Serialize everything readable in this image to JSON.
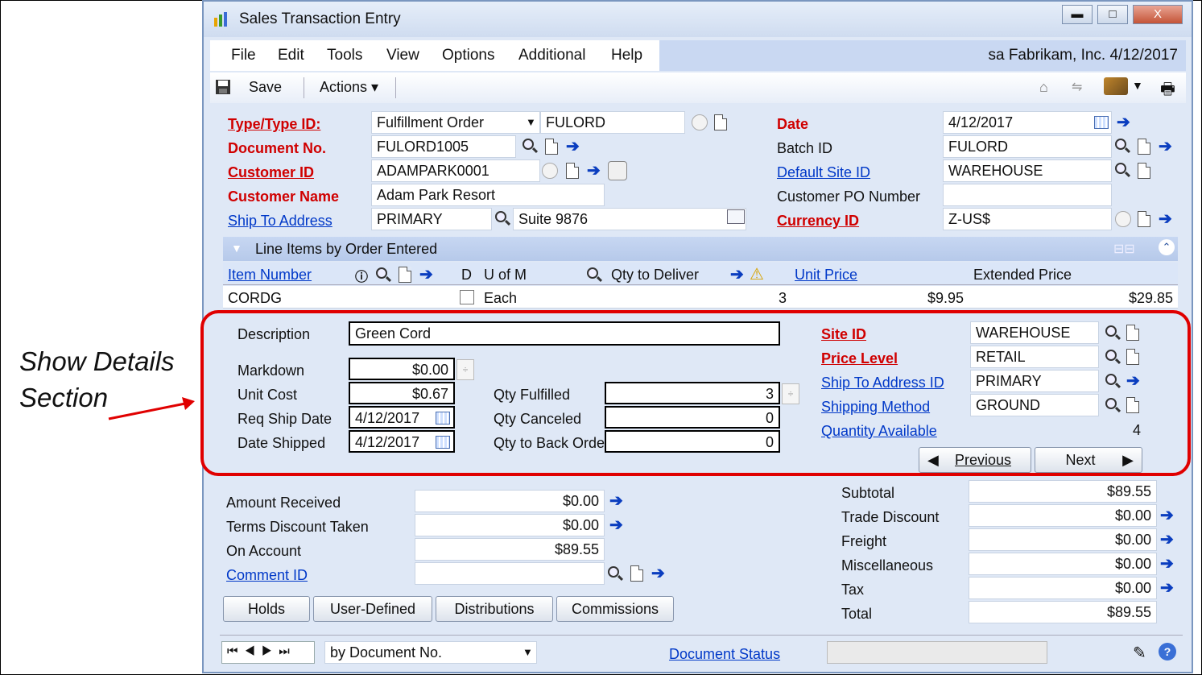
{
  "annotation": {
    "line1": "Show Details",
    "line2": "Section"
  },
  "window": {
    "title": "Sales Transaction Entry",
    "min": "▭",
    "max": "□",
    "close": "X"
  },
  "menu": {
    "items": [
      "File",
      "Edit",
      "Tools",
      "View",
      "Options",
      "Additional",
      "Help"
    ],
    "user_info": "sa  Fabrikam, Inc.  4/12/2017"
  },
  "toolbar": {
    "save": "Save",
    "actions": "Actions ▾"
  },
  "header": {
    "type_label": "Type/Type ID:",
    "type_value": "Fulfillment Order",
    "type_id": "FULORD",
    "docno_label": "Document No.",
    "docno_value": "FULORD1005",
    "customer_id_label": "Customer ID",
    "customer_id_value": "ADAMPARK0001",
    "customer_name_label": "Customer Name",
    "customer_name_value": "Adam Park Resort",
    "ship_to_label": "Ship To Address",
    "ship_to_value": "PRIMARY",
    "ship_to_addr": "Suite 9876",
    "date_label": "Date",
    "date_value": "4/12/2017",
    "batch_label": "Batch ID",
    "batch_value": "FULORD",
    "site_label": "Default Site ID",
    "site_value": "WAREHOUSE",
    "po_label": "Customer PO Number",
    "po_value": "",
    "currency_label": "Currency ID",
    "currency_value": "Z-US$"
  },
  "lines": {
    "title": "Line Items by Order Entered",
    "col_item": "Item Number",
    "col_d": "D",
    "col_uofm": "U of M",
    "col_qty": "Qty to Deliver",
    "col_price": "Unit Price",
    "col_ext": "Extended Price",
    "row": {
      "item": "CORDG",
      "uofm": "Each",
      "qty": "3",
      "price": "$9.95",
      "ext": "$29.85"
    }
  },
  "details": {
    "description_label": "Description",
    "description_value": "Green Cord",
    "markdown_label": "Markdown",
    "markdown_value": "$0.00",
    "unit_cost_label": "Unit Cost",
    "unit_cost_value": "$0.67",
    "req_ship_label": "Req Ship Date",
    "req_ship_value": "4/12/2017",
    "date_shipped_label": "Date Shipped",
    "date_shipped_value": "4/12/2017",
    "qty_fulfilled_label": "Qty Fulfilled",
    "qty_fulfilled_value": "3",
    "qty_canceled_label": "Qty Canceled",
    "qty_canceled_value": "0",
    "qty_back_label": "Qty to Back Order",
    "qty_back_value": "0",
    "site_label": "Site ID",
    "site_value": "WAREHOUSE",
    "price_level_label": "Price Level",
    "price_level_value": "RETAIL",
    "ship_to_id_label": "Ship To Address ID",
    "ship_to_id_value": "PRIMARY",
    "ship_method_label": "Shipping Method",
    "ship_method_value": "GROUND",
    "qty_avail_label": "Quantity Available",
    "qty_avail_value": "4",
    "previous": "Previous",
    "next": "Next"
  },
  "totals": {
    "amount_received_label": "Amount Received",
    "amount_received": "$0.00",
    "terms_label": "Terms Discount Taken",
    "terms": "$0.00",
    "on_account_label": "On Account",
    "on_account": "$89.55",
    "comment_label": "Comment ID",
    "comment": "",
    "subtotal_label": "Subtotal",
    "subtotal": "$89.55",
    "trade_label": "Trade Discount",
    "trade": "$0.00",
    "freight_label": "Freight",
    "freight": "$0.00",
    "misc_label": "Miscellaneous",
    "misc": "$0.00",
    "tax_label": "Tax",
    "tax": "$0.00",
    "total_label": "Total",
    "total": "$89.55"
  },
  "buttons": {
    "holds": "Holds",
    "user_defined": "User-Defined",
    "distributions": "Distributions",
    "commissions": "Commissions"
  },
  "footer": {
    "sort": "by Document No.",
    "doc_status": "Document Status"
  }
}
